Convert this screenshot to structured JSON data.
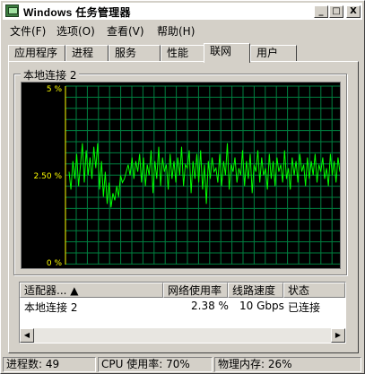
{
  "window": {
    "title": "Windows 任务管理器"
  },
  "caption_buttons": {
    "minimize": "_",
    "maximize": "□",
    "close": "X"
  },
  "menu": [
    {
      "label": "文件(F)"
    },
    {
      "label": "选项(O)"
    },
    {
      "label": "查看(V)"
    },
    {
      "label": "帮助(H)"
    }
  ],
  "tabs": [
    {
      "label": "应用程序",
      "active": false
    },
    {
      "label": "进程",
      "active": false
    },
    {
      "label": "服务",
      "active": false
    },
    {
      "label": "性能",
      "active": false
    },
    {
      "label": "联网",
      "active": true
    },
    {
      "label": "用户",
      "active": false
    }
  ],
  "graph": {
    "title": "本地连接 2",
    "y_labels": [
      "5 %",
      "2.50 %",
      "0 %"
    ],
    "line_color": "#00ff00",
    "grid_color": "#008040",
    "marker_color": "#ffff00"
  },
  "chart_data": {
    "type": "line",
    "ylim": [
      0,
      5
    ],
    "series": [
      {
        "values": [
          2.6,
          2.1,
          2.9,
          2.4,
          3.1,
          2.2,
          2.8,
          3.4,
          2.3,
          3.2,
          2.5,
          3.0,
          2.4,
          3.3,
          2.7,
          3.4,
          2.1,
          2.9,
          1.9,
          2.6,
          1.7,
          2.3,
          1.6,
          2.0,
          1.8,
          2.2,
          1.9,
          2.5,
          2.3,
          2.4,
          2.6,
          2.8,
          2.5,
          3.0,
          2.4,
          2.9,
          2.6,
          3.1,
          2.3,
          3.0,
          2.2,
          2.8,
          2.5,
          3.2,
          2.0,
          2.9,
          2.4,
          3.3,
          2.2,
          3.0,
          2.6,
          2.8,
          2.1,
          3.1,
          2.4,
          2.9,
          2.3,
          3.0,
          2.5,
          3.3,
          2.2,
          2.8,
          2.7,
          3.2,
          2.0,
          2.9,
          2.4,
          3.1,
          2.3,
          3.2,
          2.1,
          2.8,
          1.7,
          2.9,
          2.4,
          3.0,
          2.6,
          2.7,
          2.3,
          3.1,
          2.2,
          2.9,
          2.5,
          3.4,
          2.1,
          2.8,
          2.6,
          3.0,
          2.3,
          2.7,
          2.5,
          3.2,
          2.2,
          2.9,
          2.4,
          3.1,
          2.0,
          2.8,
          2.6,
          3.2,
          2.3,
          3.0,
          2.5,
          2.7,
          2.1,
          3.1,
          2.4,
          2.9,
          2.2,
          3.0,
          2.6,
          2.8,
          2.3,
          3.2,
          2.4,
          2.7,
          2.1,
          3.0,
          2.5,
          2.9,
          2.3,
          3.1,
          2.6,
          2.8,
          2.2,
          3.0,
          2.4,
          2.9,
          2.5,
          3.1,
          2.3,
          2.8,
          2.6,
          3.0,
          2.4,
          2.7,
          2.2,
          3.1,
          2.5,
          2.9,
          2.3,
          3.0,
          2.6
        ]
      }
    ]
  },
  "table": {
    "columns": [
      "适配器... ▲",
      "网络使用率",
      "线路速度",
      "状态"
    ],
    "rows": [
      {
        "adapter": "本地连接 2",
        "usage": "2.38 %",
        "speed": "10 Gbps",
        "status": "已连接"
      }
    ]
  },
  "status": {
    "processes": "进程数: 49",
    "cpu": "CPU 使用率: 70%",
    "memory": "物理内存: 26%"
  }
}
